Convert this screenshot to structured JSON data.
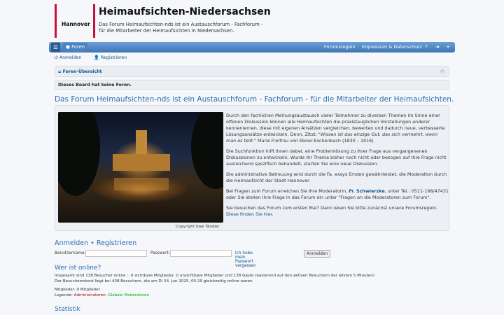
{
  "header": {
    "logo_text": "Hannover",
    "title": "Heimaufsichten-Niedersachsen",
    "description": "Das Forum Heimaufsichten-nds ist ein Austauschforum - Fachforum - für die Mitarbeiter der Heimaufsichten in Niedersachsen."
  },
  "navbar": {
    "menu_icon": "menu-icon",
    "forum_label": "Foren",
    "rules_label": "Forumsregeln",
    "imprint_label": "Impressum & Datenschutz"
  },
  "userbar": {
    "login_label": "Anmelden",
    "register_label": "Registrieren"
  },
  "breadcrumb": {
    "label": "Foren-Übersicht"
  },
  "notice": "Dieses Board hat keine Foren.",
  "main": {
    "heading": "Das Forum Heimaufsichten-nds ist ein Austauschforum - Fachforum - für die Mitarbeiter der Heimaufsichten.",
    "copyright": "Copyright Uwe Tändler",
    "p1a": "Durch den fachlichen Meinungsaustausch vieler Teilnehmer zu diversen Themen im Sinne einer offenen Diskussion können alle Heimaufsichten die praxistauglichen Vorstellungen anderer kennenlernen, diese mit eigenen Ansätzen vergleichen, bewerten und dadurch neue, verbesserte Lösungsansätze entwickeln. Denn, Zitat: ",
    "p1quote": "\"Wissen ist das einzige Gut, das sich vermehrt, wenn man es teilt.\"",
    "p1b": " Marie Freifrau von Ebner-Eschenbach (1830 – 1916)",
    "p2": "Die Suchfunktion hilft Ihnen dabei, eine Problemlösung zu Ihrer Frage aus vergangenenen Diskussionen zu entwickeln. Wurde Ihr Thema bisher noch nicht oder bezogen auf Ihre Frage nicht ausreichend spezifisch behandelt, starten Sie eine neue Diskussion.",
    "p3": "Die administrative Betreuung wird durch die Fa. exsys Emden gewährleistet, die Moderation durch die Heimaufsicht der Stadt Hannover.",
    "p4a": "Bei Fragen zum Forum erreichen Sie Ihre Moderatorin, ",
    "p4link": "Fr. Schwierzke",
    "p4b": ", unter Tel.: 0511-168/47431 oder Sie stellen Ihre Frage in das Forum ein unter \"Fragen an die Moderatoren zum Forum\".",
    "p5a": "Sie besuchen das Forum zum ersten Mal? Dann lesen Sie bitte zunächst unsere Forumsregeln.",
    "p5link": "Diese finden Sie hier."
  },
  "login": {
    "heading_login": "Anmelden",
    "heading_sep": "•",
    "heading_register": "Registrieren",
    "username_label": "Benutzername:",
    "password_label": "Passwort:",
    "forgot_label": "Ich habe mein Passwort vergessen",
    "submit_label": "Anmelden"
  },
  "online": {
    "heading": "Wer ist online?",
    "line1": "Insgesamt sind 138 Besucher online :: 0 sichtbare Mitglieder, 0 unsichtbare Mitglieder und 138 Gäste (basierend auf den aktiven Besuchern der letzten 5 Minuten)",
    "line2": "Der Besucherrekord liegt bei 438 Besuchern, die am Di 24. Jun 2025, 05:29 gleichzeitig online waren.",
    "members": "Mitglieder: 0 Mitglieder",
    "legend_label": "Legende:",
    "legend_admins": "Administratoren",
    "legend_sep": ",",
    "legend_mods": "Globale Moderatoren"
  },
  "stats": {
    "heading": "Statistik"
  },
  "colors": {
    "accent": "#3e75b5",
    "logo_red": "#c8103e",
    "link": "#105289",
    "heading": "#2b6cb0"
  }
}
